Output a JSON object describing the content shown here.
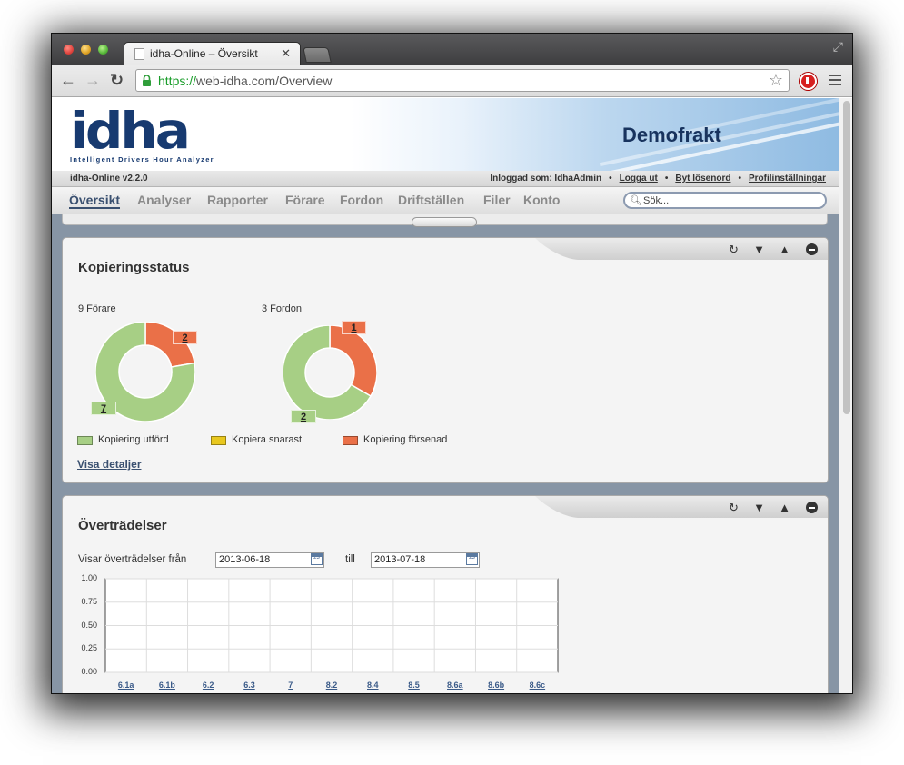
{
  "browser": {
    "tab_title": "idha-Online – Översikt",
    "url_scheme": "https://",
    "url_rest": "web-idha.com/Overview"
  },
  "header": {
    "logo_text": "idha",
    "logo_tagline": "Intelligent Drivers Hour Analyzer",
    "company": "Demofrakt",
    "version": "idha-Online v2.2.0",
    "logged_in_as": "Inloggad som: IdhaAdmin",
    "logout": "Logga ut",
    "change_password": "Byt lösenord",
    "profile_settings": "Profilinställningar"
  },
  "nav": {
    "items": [
      "Översikt",
      "Analyser",
      "Rapporter",
      "Förare",
      "Fordon",
      "Driftställen",
      "Filer",
      "Konto"
    ],
    "active": "Översikt",
    "search_placeholder": "Sök..."
  },
  "copy_status": {
    "title": "Kopieringsstatus",
    "drivers_label": "9 Förare",
    "vehicles_label": "3 Fordon",
    "drivers_done": "7",
    "drivers_late": "2",
    "vehicles_done": "2",
    "vehicles_late": "1",
    "legend": [
      "Kopiering utförd",
      "Kopiera snarast",
      "Kopiering försenad"
    ],
    "details_link": "Visa detaljer"
  },
  "violations": {
    "title": "Överträdelser",
    "showing_from": "Visar överträdelser från",
    "from_date": "2013-06-18",
    "until_label": "till",
    "to_date": "2013-07-18"
  },
  "colors": {
    "done": "#a7cf85",
    "soon": "#e8c71e",
    "late": "#ea7048"
  },
  "chart_data": [
    {
      "type": "pie",
      "title": "",
      "categories": [
        "Kopiering utförd",
        "Kopiering försenad"
      ],
      "values": [
        7,
        2
      ]
    },
    {
      "type": "pie",
      "title": "",
      "categories": [
        "Kopiering utförd",
        "Kopiering försenad"
      ],
      "values": [
        2,
        1
      ]
    },
    {
      "type": "bar",
      "title": "",
      "categories": [
        "6.1a",
        "6.1b",
        "6.2",
        "6.3",
        "7",
        "8.2",
        "8.4",
        "8.5",
        "8.6a",
        "8.6b",
        "8.6c"
      ],
      "values": [
        0,
        0,
        0,
        0,
        0,
        0,
        0,
        0,
        0,
        0,
        0
      ],
      "yticks": [
        "1.00",
        "0.75",
        "0.50",
        "0.25",
        "0.00"
      ],
      "ylim": [
        0,
        1
      ],
      "grid": true
    }
  ]
}
